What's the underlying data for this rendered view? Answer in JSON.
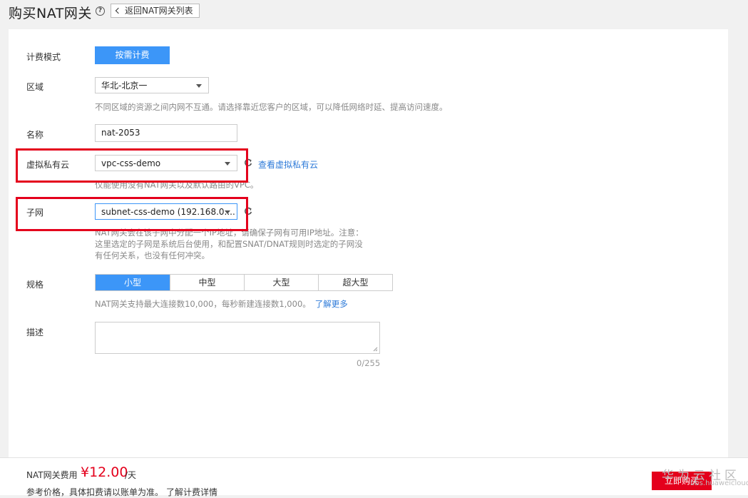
{
  "header": {
    "title": "购买NAT网关",
    "help_glyph": "?",
    "back_label": "返回NAT网关列表"
  },
  "form": {
    "billing": {
      "label": "计费模式",
      "value": "按需计费"
    },
    "region": {
      "label": "区域",
      "value": "华北-北京一",
      "hint": "不同区域的资源之间内网不互通。请选择靠近您客户的区域，可以降低网络时延、提高访问速度。"
    },
    "name": {
      "label": "名称",
      "value": "nat-2053"
    },
    "vpc": {
      "label": "虚拟私有云",
      "value": "vpc-css-demo",
      "link": "查看虚拟私有云",
      "hint": "仅能使用没有NAT网关以及默认路由的VPC。"
    },
    "subnet": {
      "label": "子网",
      "value": "subnet-css-demo (192.168.0....",
      "hint_lines": [
        "NAT网关会在该子网中分配一个IP地址，请确保子网有可用IP地址。注意：",
        "这里选定的子网是系统后台使用，和配置SNAT/DNAT规则时选定的子网没",
        "有任何关系，也没有任何冲突。"
      ]
    },
    "spec": {
      "label": "规格",
      "options": [
        "小型",
        "中型",
        "大型",
        "超大型"
      ],
      "selected": "小型",
      "hint": "NAT网关支持最大连接数10,000，每秒新建连接数1,000。",
      "link": "了解更多"
    },
    "description": {
      "label": "描述",
      "counter": "0/255"
    }
  },
  "footer": {
    "fee_label": "NAT网关费用",
    "fee_amount": "¥12.00",
    "fee_unit": "/天",
    "note": "参考价格，具体扣费请以账单为准。",
    "note_link": "了解计费详情",
    "buy_label": "立即购买"
  },
  "watermark": {
    "text": "华为云社区",
    "url": "bbs.huaweicloud.com"
  },
  "colors": {
    "accent": "#3c96f8",
    "highlight": "#e4001c",
    "link": "#2d7ad8"
  }
}
